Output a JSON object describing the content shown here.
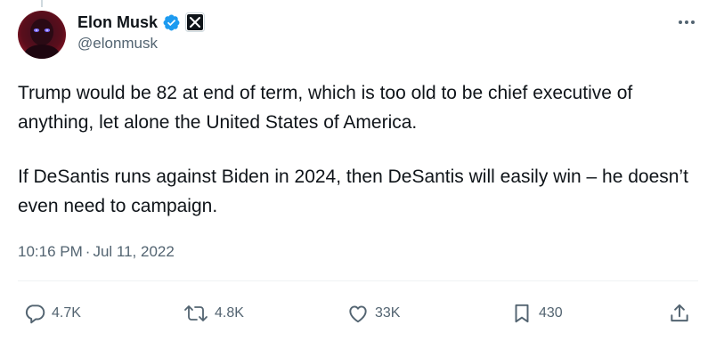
{
  "author": {
    "display_name": "Elon Musk",
    "handle": "@elonmusk",
    "avatar_icon": "avatar-image",
    "verified_icon": "verified-badge-icon",
    "affiliation_icon": "x-logo-icon"
  },
  "tweet": {
    "paragraph_1": "Trump would be 82 at end of term, which is too old to be chief executive of anything, let alone the United States of America.",
    "paragraph_2": "If DeSantis runs against Biden in 2024, then DeSantis will easily win – he doesn’t even need to campaign.",
    "time": "10:16 PM",
    "separator": "·",
    "date": "Jul 11, 2022"
  },
  "actions": {
    "replies": "4.7K",
    "reposts": "4.8K",
    "likes": "33K",
    "bookmarks": "430"
  },
  "colors": {
    "text": "#0f1419",
    "secondary": "#536471",
    "verified": "#1d9bf0",
    "divider": "#eff3f4"
  }
}
